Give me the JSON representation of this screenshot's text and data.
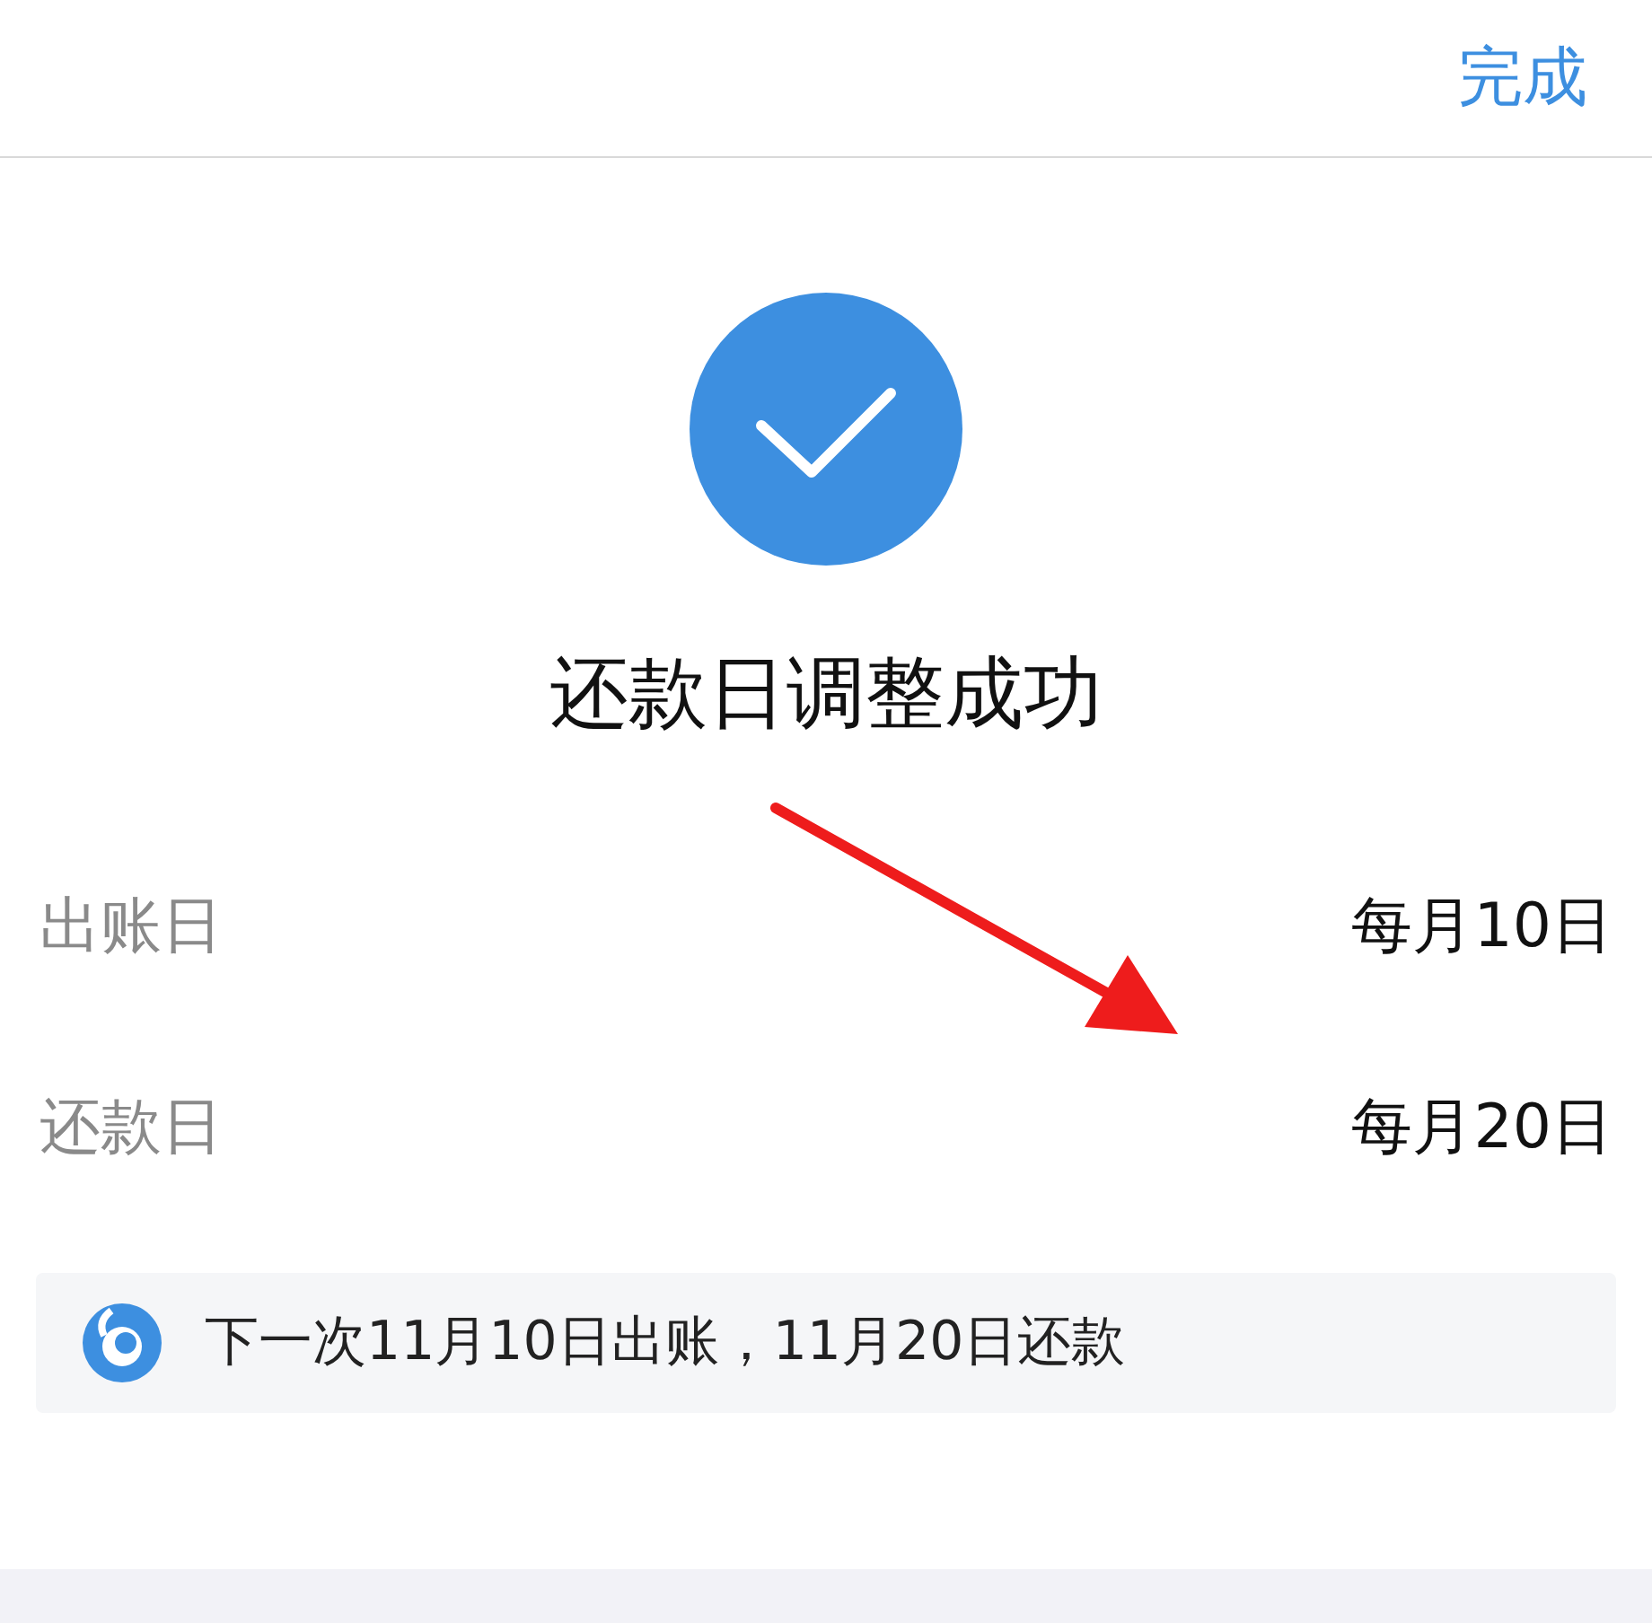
{
  "nav_bar": {
    "done_button": "完成"
  },
  "result": {
    "title": "还款日调整成功"
  },
  "rows": [
    {
      "label": "出账日",
      "value": "每月10日"
    },
    {
      "label": "还款日",
      "value": "每月20日"
    }
  ],
  "notice": {
    "text": "下一次11月10日出账，11月20日还款"
  }
}
